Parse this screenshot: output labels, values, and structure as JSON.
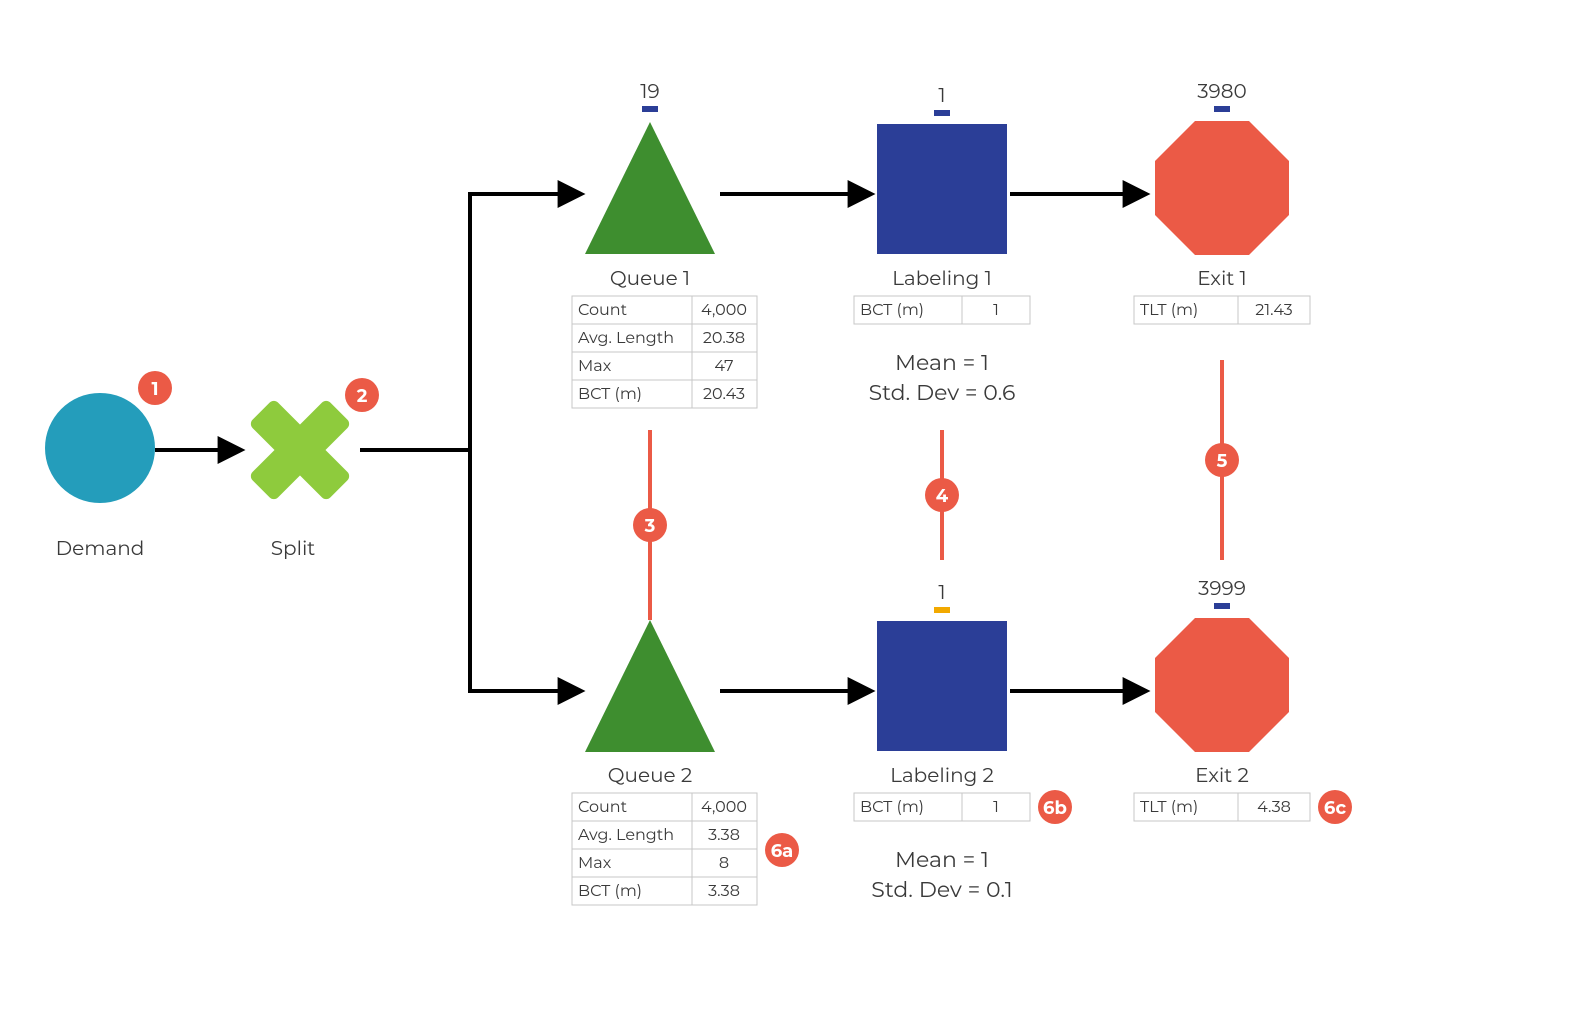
{
  "demand": {
    "label": "Demand",
    "badge": "1"
  },
  "split": {
    "label": "Split",
    "badge": "2"
  },
  "queue1": {
    "label": "Queue 1",
    "counter": "19",
    "rows": [
      {
        "label": "Count",
        "value": "4,000"
      },
      {
        "label": "Avg. Length",
        "value": "20.38"
      },
      {
        "label": "Max",
        "value": "47"
      },
      {
        "label": "BCT (m)",
        "value": "20.43"
      }
    ]
  },
  "queue2": {
    "label": "Queue 2",
    "badge": "6a",
    "rows": [
      {
        "label": "Count",
        "value": "4,000"
      },
      {
        "label": "Avg. Length",
        "value": "3.38"
      },
      {
        "label": "Max",
        "value": "8"
      },
      {
        "label": "BCT (m)",
        "value": "3.38"
      }
    ]
  },
  "labeling1": {
    "label": "Labeling 1",
    "counter": "1",
    "row": {
      "label": "BCT (m)",
      "value": "1"
    },
    "note1": "Mean = 1",
    "note2": "Std. Dev = 0.6"
  },
  "labeling2": {
    "label": "Labeling 2",
    "counter": "1",
    "badge": "6b",
    "row": {
      "label": "BCT (m)",
      "value": "1"
    },
    "note1": "Mean = 1",
    "note2": "Std. Dev = 0.1"
  },
  "exit1": {
    "label": "Exit 1",
    "counter": "3980",
    "row": {
      "label": "TLT (m)",
      "value": "21.43"
    }
  },
  "exit2": {
    "label": "Exit 2",
    "counter": "3999",
    "badge": "6c",
    "row": {
      "label": "TLT (m)",
      "value": "4.38"
    }
  },
  "badges": {
    "b3": "3",
    "b4": "4",
    "b5": "5"
  },
  "colors": {
    "demand": "#249dbb",
    "split": "#8ecb3d",
    "queue": "#3e8e2f",
    "activity": "#2b3e97",
    "exit": "#eb5a46",
    "badge": "#eb5a46",
    "tick_blue": "#2b3e97",
    "tick_orange": "#f2a900"
  }
}
